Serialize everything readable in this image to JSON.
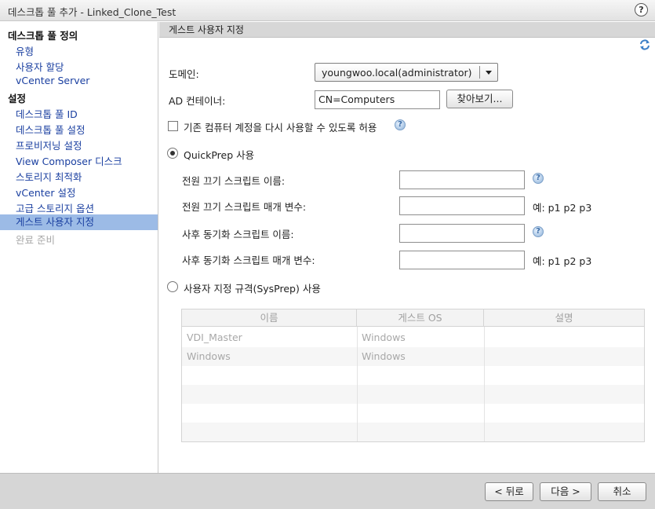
{
  "window": {
    "title": "데스크톱 풀 추가 - Linked_Clone_Test",
    "help_label": "?"
  },
  "sidebar": {
    "sections": [
      {
        "heading": "데스크톱 풀 정의",
        "items": [
          "유형",
          "사용자 할당",
          "vCenter Server"
        ]
      },
      {
        "heading": "설정",
        "items": [
          "데스크톱 풀 ID",
          "데스크톱 풀 설정",
          "프로비저닝 설정",
          "View Composer 디스크",
          "스토리지 최적화",
          "vCenter 설정",
          "고급 스토리지 옵션",
          "게스트 사용자 지정",
          "완료 준비"
        ]
      }
    ],
    "selected_item": "게스트 사용자 지정",
    "disabled_item": "완료 준비"
  },
  "main": {
    "section_title": "게스트 사용자 지정",
    "refresh_icon": "refresh-icon",
    "domain_label": "도메인:",
    "domain_value": "youngwoo.local(administrator)",
    "ad_container_label": "AD 컨테이너:",
    "ad_container_value": "CN=Computers",
    "browse_button": "찾아보기...",
    "reuse_checkbox_label": "기존 컴퓨터 계정을 다시 사용할 수 있도록 허용",
    "reuse_checked": false,
    "quickprep_label": "QuickPrep 사용",
    "quickprep_selected": true,
    "poweroff_script_label": "전원 끄기 스크립트 이름:",
    "poweroff_params_label": "전원 끄기 스크립트 매개 변수:",
    "postsync_script_label": "사후 동기화 스크립트 이름:",
    "postsync_params_label": "사후 동기화 스크립트 매개 변수:",
    "params_example": "예: p1 p2 p3",
    "sysprep_label": "사용자 지정 규격(SysPrep) 사용",
    "sysprep_selected": false,
    "table": {
      "columns": [
        "이름",
        "게스트 OS",
        "설명"
      ],
      "rows": [
        [
          "VDI_Master",
          "Windows",
          ""
        ],
        [
          "Windows",
          "Windows",
          ""
        ]
      ]
    }
  },
  "footer": {
    "back_button": "< 뒤로",
    "next_button": "다음 >",
    "cancel_button": "취소"
  }
}
